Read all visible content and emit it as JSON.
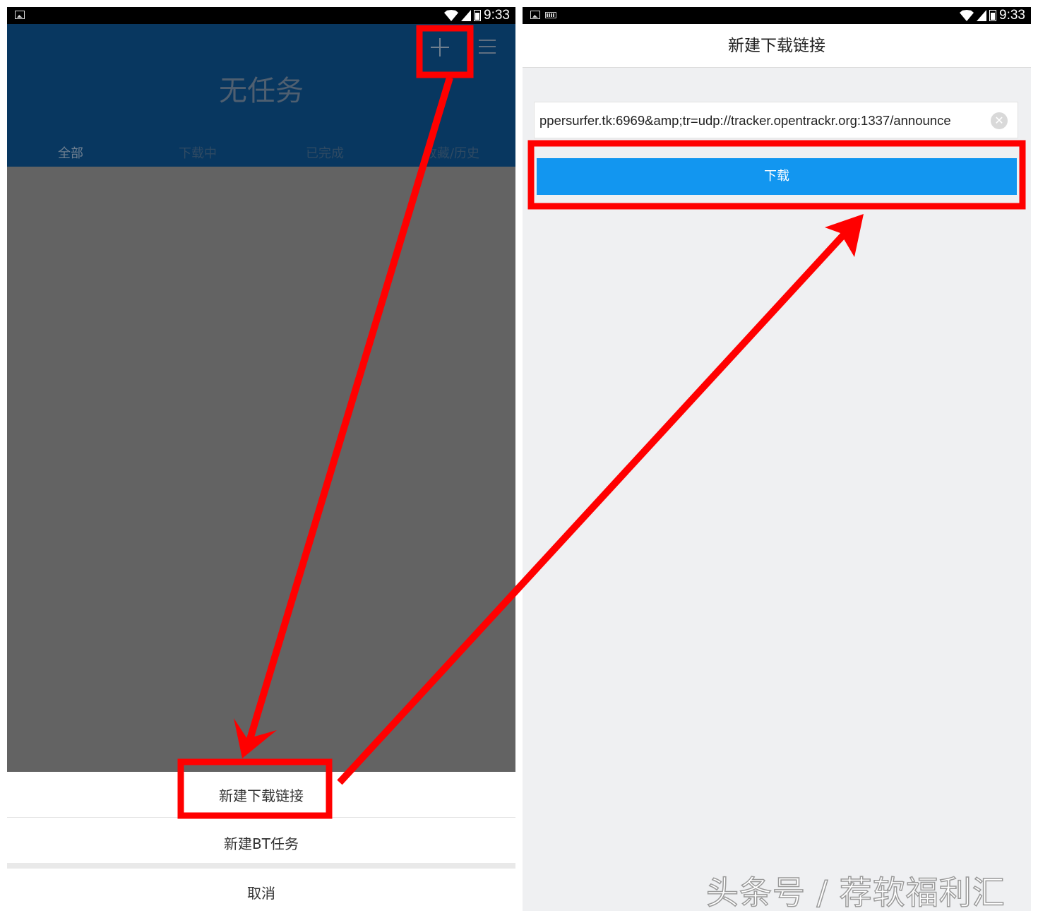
{
  "status_bar": {
    "time": "9:33"
  },
  "left_screen": {
    "title": "无任务",
    "tabs": [
      {
        "label": "全部"
      },
      {
        "label": "下载中"
      },
      {
        "label": "已完成"
      },
      {
        "label": "收藏/历史"
      }
    ],
    "icons": [
      "plus-icon",
      "list-menu-icon"
    ],
    "action_sheet": {
      "items": [
        {
          "label": "新建下载链接"
        },
        {
          "label": "新建BT任务"
        }
      ],
      "cancel": "取消"
    }
  },
  "right_screen": {
    "title": "新建下载链接",
    "url_input": {
      "value": "ppersurfer.tk:6969&amp;tr=udp://tracker.opentrackr.org:1337/announce"
    },
    "download_button": "下载"
  },
  "annotations": {
    "highlight_color": "#ff0000"
  },
  "watermark": "头条号 / 荐软福利汇",
  "colors": {
    "header_bg": "#083760",
    "dim_overlay": "#636363",
    "accent_blue": "#1296f0",
    "dialog_bg": "#eff0f2"
  }
}
